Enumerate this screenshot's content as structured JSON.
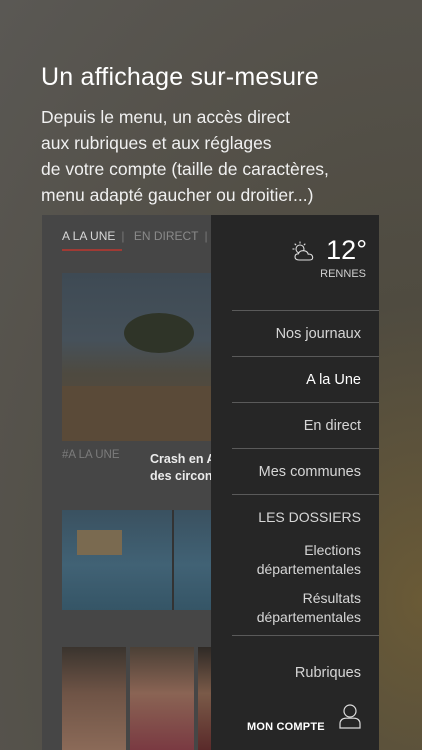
{
  "promo": {
    "title": "Un affichage sur-mesure",
    "description": "Depuis le menu, un accès direct\naux rubriques et aux réglages\nde votre compte (taille de caractères,\nmenu adapté gaucher ou droitier...)"
  },
  "app": {
    "tabs": {
      "active": "A LA UNE",
      "separator": "|",
      "second": "EN DIRECT",
      "third_separator": "|"
    },
    "article": {
      "kicker": "#A LA UNE",
      "headline": "Crash en A\ndes circon"
    }
  },
  "drawer": {
    "weather": {
      "icon": "partly-cloudy-icon",
      "temperature": "12°",
      "city": "RENNES"
    },
    "menu": [
      {
        "label": "Nos journaux",
        "active": false
      },
      {
        "label": "A la Une",
        "active": true
      },
      {
        "label": "En direct",
        "active": false
      },
      {
        "label": "Mes communes",
        "active": false
      }
    ],
    "section": "LES DOSSIERS",
    "dossiers": [
      {
        "label": "Elections\ndépartementales"
      },
      {
        "label": "Résultats\ndépartementales"
      }
    ],
    "rubriques": "Rubriques",
    "account": {
      "label": "MON COMPTE",
      "icon": "user-icon"
    }
  }
}
